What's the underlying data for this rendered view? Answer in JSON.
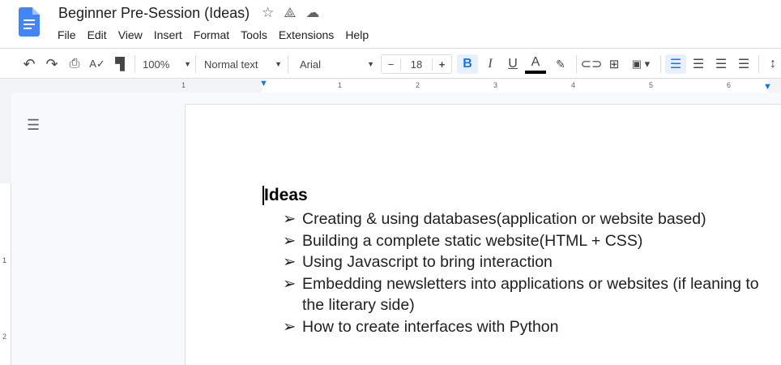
{
  "document": {
    "title": "Beginner Pre-Session (Ideas)"
  },
  "title_icons": [
    "star-icon",
    "move-to-drive-icon",
    "cloud-saved-icon"
  ],
  "menu": [
    "File",
    "Edit",
    "View",
    "Insert",
    "Format",
    "Tools",
    "Extensions",
    "Help"
  ],
  "toolbar": {
    "zoom": "100%",
    "style": "Normal text",
    "font": "Arial",
    "font_size": "18",
    "minus": "−",
    "plus": "+",
    "bold": "B",
    "italic": "I",
    "underline": "U",
    "text_color": "A",
    "text_color_value": "#000000"
  },
  "ruler": {
    "numbers": [
      "1",
      "1",
      "1",
      "2",
      "3",
      "4",
      "5",
      "6"
    ]
  },
  "vruler": {
    "numbers": [
      "1",
      "2"
    ]
  },
  "content": {
    "heading": "Ideas",
    "bullet_glyph": "➢",
    "items": [
      "Creating & using databases(application or website based)",
      "Building a complete static website(HTML + CSS)",
      "Using Javascript to bring interaction",
      "Embedding newsletters into applications or websites (if leaning to the literary side)",
      "How to create interfaces with Python"
    ]
  },
  "colors": {
    "accent": "#1a73e8",
    "active_bg": "#e8f0fe"
  }
}
